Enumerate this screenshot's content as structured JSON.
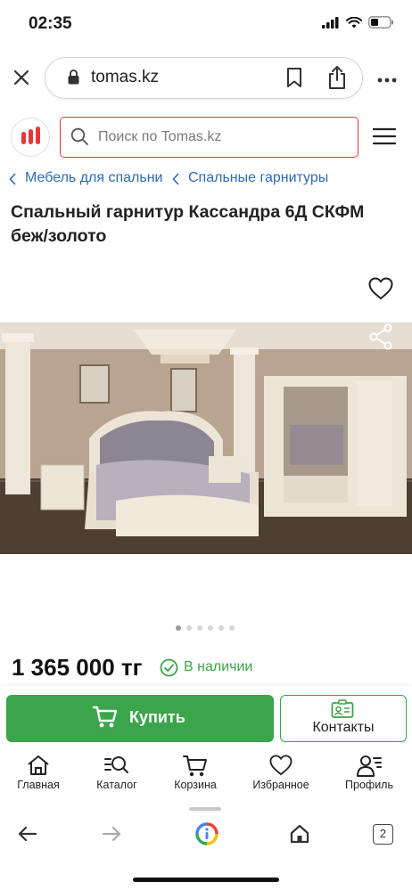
{
  "status_bar": {
    "time": "02:35"
  },
  "browser": {
    "url": "tomas.kz",
    "tab_count": "2",
    "icons": [
      "close-icon",
      "lock-icon",
      "bookmark-icon",
      "share-icon",
      "more-icon",
      "back-icon",
      "forward-icon",
      "assistant-icon",
      "home-icon"
    ]
  },
  "site_header": {
    "search_placeholder": "Поиск по Tomas.kz",
    "brand_color": "#e4393c"
  },
  "breadcrumb": [
    {
      "label": "Мебель для спальни"
    },
    {
      "label": "Спальные гарнитуры"
    }
  ],
  "product": {
    "title": "Спальный гарнитур Кассандра 6Д СКФМ беж/золото",
    "price": "1 365 000 тг",
    "stock": "В наличии",
    "gallery_count": 6,
    "gallery_active": 0
  },
  "actions": {
    "buy_label": "Купить",
    "contacts_label": "Контакты",
    "accent_color": "#3aa54a"
  },
  "bottom_nav": [
    {
      "label": "Главная",
      "icon": "home-icon"
    },
    {
      "label": "Каталог",
      "icon": "catalog-search-icon"
    },
    {
      "label": "Корзина",
      "icon": "cart-icon"
    },
    {
      "label": "Избранное",
      "icon": "heart-icon"
    },
    {
      "label": "Профиль",
      "icon": "profile-icon"
    }
  ]
}
